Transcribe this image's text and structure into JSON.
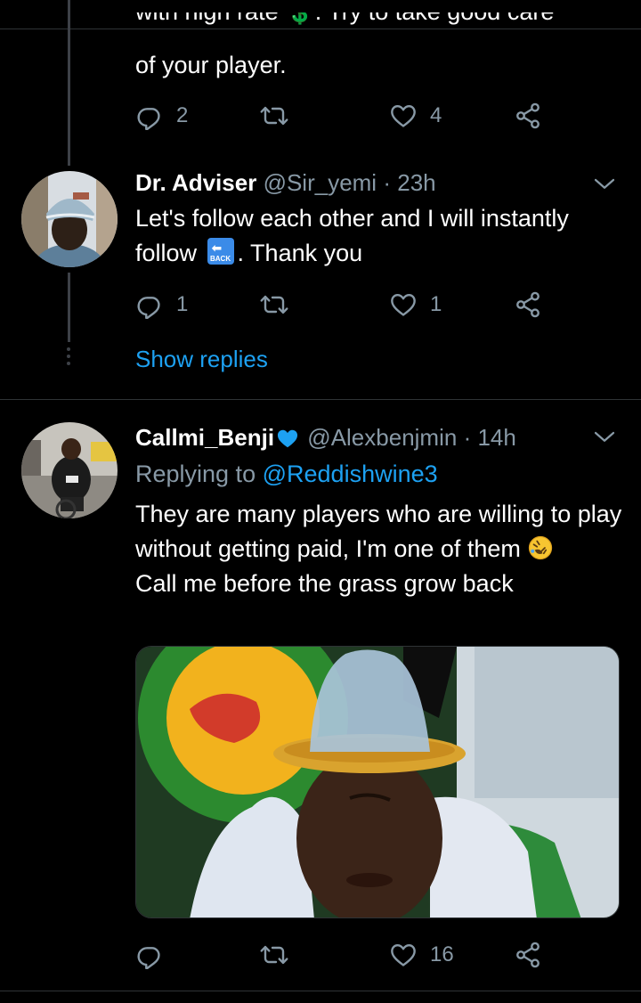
{
  "tweet1": {
    "text_cut": "with high rate 💲. Try to take good care",
    "text_line2": "of your player.",
    "actions": {
      "reply_count": "2",
      "retweet_count": "",
      "like_count": "4"
    }
  },
  "tweet2": {
    "name": "Dr. Adviser",
    "handle": "@Sir_yemi",
    "separator": "·",
    "time": "23h",
    "text_before": "Let's follow each other and I will instantly follow",
    "emoji_label": "BACK",
    "text_after": ".  Thank you",
    "actions": {
      "reply_count": "1",
      "retweet_count": "",
      "like_count": "1"
    },
    "show_replies": "Show replies"
  },
  "tweet3": {
    "name": "Callmi_Benji",
    "handle": "@Alexbenjmin",
    "separator": "·",
    "time": "14h",
    "replying_prefix": "Replying to",
    "replying_handle": "@Reddishwine3",
    "text_p1": "They are many players who are willing to play without getting paid, I'm one of them",
    "text_p2": "Call me before the grass grow back",
    "actions": {
      "reply_count": "",
      "retweet_count": "",
      "like_count": "16"
    }
  },
  "colors": {
    "background": "#000000",
    "secondary_text": "#8899a6",
    "link_blue": "#1da1f2",
    "verified_blue": "#1da1f2",
    "divider": "#2f3336"
  }
}
